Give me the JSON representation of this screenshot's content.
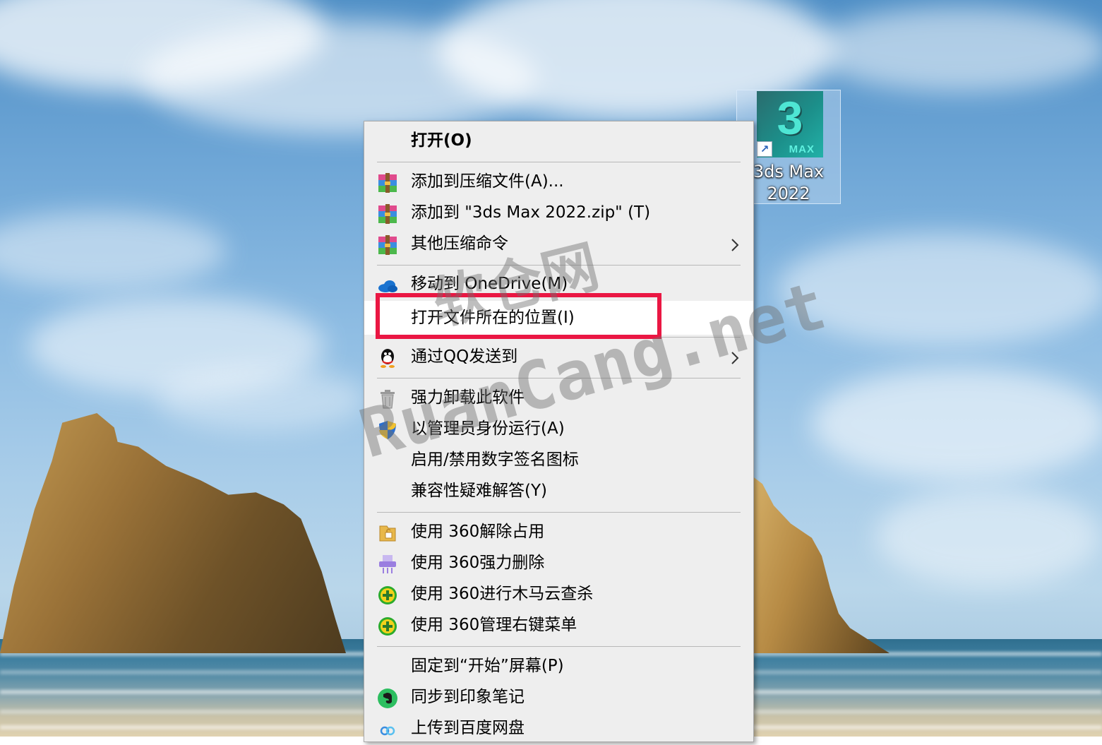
{
  "desktop": {
    "icon": {
      "tile_number": "3",
      "tile_text": "MAX",
      "label_line1": "3ds Max",
      "label_line2": "2022"
    }
  },
  "menu": {
    "items": [
      {
        "label": "打开(O)",
        "icon": "none"
      },
      {
        "label": "添加到压缩文件(A)...",
        "icon": "winrar-icon"
      },
      {
        "label": "添加到 \"3ds Max 2022.zip\" (T)",
        "icon": "winrar-icon"
      },
      {
        "label": "其他压缩命令",
        "icon": "winrar-icon",
        "submenu": true
      },
      {
        "label": "移动到 OneDrive(M)",
        "icon": "onedrive-icon"
      },
      {
        "label": "打开文件所在的位置(I)",
        "icon": "none",
        "highlighted": true
      },
      {
        "label": "通过QQ发送到",
        "icon": "qq-icon",
        "submenu": true
      },
      {
        "label": "强力卸载此软件",
        "icon": "trash-icon"
      },
      {
        "label": "以管理员身份运行(A)",
        "icon": "uac-shield-icon"
      },
      {
        "label": "启用/禁用数字签名图标",
        "icon": "none"
      },
      {
        "label": "兼容性疑难解答(Y)",
        "icon": "none"
      },
      {
        "label": "使用 360解除占用",
        "icon": "unlock-file-icon"
      },
      {
        "label": "使用 360强力删除",
        "icon": "shredder-icon"
      },
      {
        "label": "使用 360进行木马云查杀",
        "icon": "360-plus-icon"
      },
      {
        "label": "使用 360管理右键菜单",
        "icon": "360-plus-icon"
      },
      {
        "label": "固定到“开始”屏幕(P)",
        "icon": "none"
      },
      {
        "label": "同步到印象笔记",
        "icon": "evernote-icon"
      },
      {
        "label": "上传到百度网盘",
        "icon": "baidu-netdisk-icon"
      }
    ]
  },
  "watermark": {
    "line1": "软仓网",
    "line2": "RuanCang.net"
  },
  "colors": {
    "menu_bg": "#eeeeee",
    "highlight": "#ffffff",
    "red_box": "#ea1743"
  }
}
